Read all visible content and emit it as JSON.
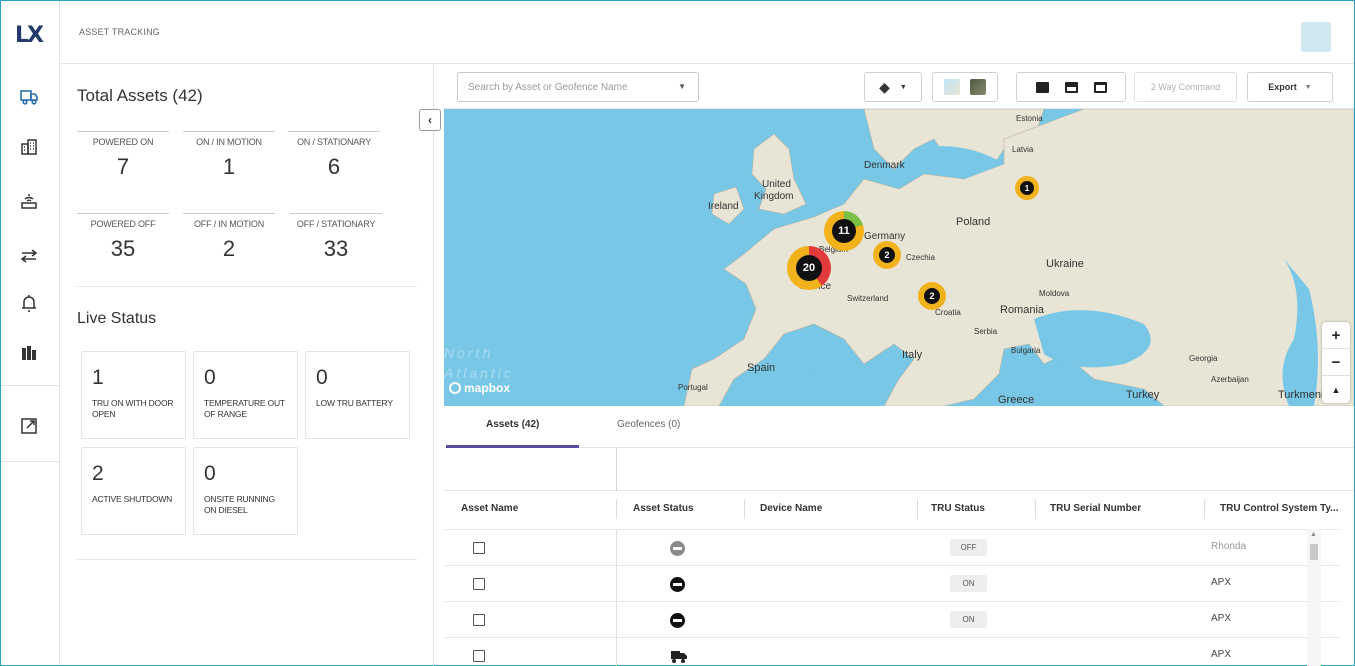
{
  "app": {
    "logo": "LX",
    "title": "ASSET TRACKING"
  },
  "nav": [
    {
      "icon": "truck-icon"
    },
    {
      "icon": "building-icon"
    },
    {
      "icon": "router-icon"
    },
    {
      "icon": "transfer-icon"
    },
    {
      "icon": "alarm-icon"
    },
    {
      "icon": "warehouse-icon"
    },
    {
      "icon": "external-link-icon"
    }
  ],
  "summary": {
    "heading": "Total Assets (42)",
    "stats": [
      {
        "label": "POWERED ON",
        "value": "7"
      },
      {
        "label": "ON / IN MOTION",
        "value": "1"
      },
      {
        "label": "ON / STATIONARY",
        "value": "6"
      },
      {
        "label": "POWERED OFF",
        "value": "35"
      },
      {
        "label": "OFF / IN MOTION",
        "value": "2"
      },
      {
        "label": "OFF / STATIONARY",
        "value": "33"
      }
    ],
    "live_heading": "Live Status",
    "cards": [
      {
        "value": "1",
        "text": "TRU ON WITH DOOR OPEN"
      },
      {
        "value": "0",
        "text": "TEMPERATURE OUT OF RANGE"
      },
      {
        "value": "0",
        "text": "LOW TRU BATTERY"
      },
      {
        "value": "2",
        "text": "ACTIVE SHUTDOWN"
      },
      {
        "value": "0",
        "text": "ONSITE RUNNING ON DIESEL"
      }
    ]
  },
  "toolbar": {
    "search_placeholder": "Search by Asset or Geofence Name",
    "command": "2 Way Command",
    "export": "Export"
  },
  "map": {
    "labels": [
      "Estonia",
      "Latvia",
      "Denmark",
      "United",
      "Kingdom",
      "Ireland",
      "Poland",
      "Germany",
      "Belgium",
      "Czechia",
      "Ukraine",
      "France",
      "Switzerland",
      "Moldova",
      "Croatia",
      "Romania",
      "Serbia",
      "Italy",
      "Bulgaria",
      "Georgia",
      "Spain",
      "Portugal",
      "Azerbaijan",
      "Greece",
      "Turkey",
      "Turkmenis",
      "North",
      "Atlantic"
    ],
    "clusters": [
      "1",
      "11",
      "2",
      "20",
      "2"
    ],
    "attribution": "mapbox"
  },
  "tabs": {
    "assets": "Assets (42)",
    "geofences": "Geofences (0)"
  },
  "table": {
    "headers": [
      "Asset Name",
      "Asset Status",
      "Device Name",
      "TRU Status",
      "TRU Serial Number",
      "TRU Control System Ty..."
    ],
    "rows": [
      {
        "status_color": "#8a8a8a",
        "tru": "OFF",
        "control": "Rhonda"
      },
      {
        "status_color": "#111111",
        "tru": "ON",
        "control": "APX"
      },
      {
        "status_color": "#111111",
        "tru": "ON",
        "control": "APX"
      },
      {
        "status_icon": "truck-icon",
        "tru": "",
        "control": "APX"
      }
    ]
  },
  "colors": {
    "accent": "#5a4b9e",
    "cluster": "#f2b21c",
    "ocean": "#79c7e6",
    "land": "#e8e4d6"
  }
}
